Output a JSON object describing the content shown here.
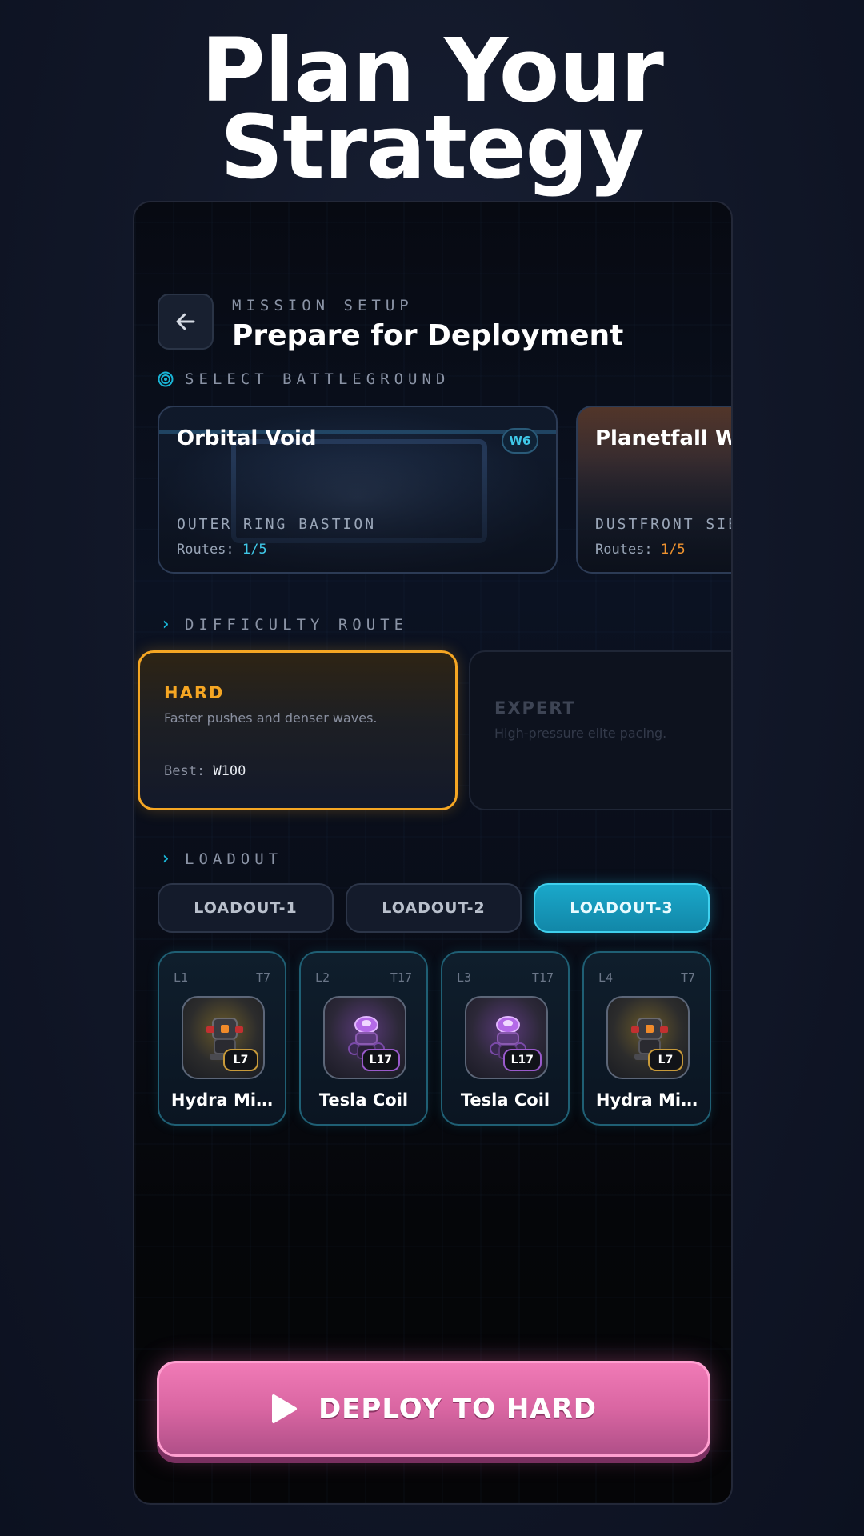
{
  "headline": {
    "line1": "Plan Your",
    "line2": "Strategy"
  },
  "header": {
    "eyebrow": "MISSION SETUP",
    "title": "Prepare for Deployment",
    "back_icon": "arrow-left-icon"
  },
  "battleground": {
    "section_label": "SELECT BATTLEGROUND",
    "section_icon": "target-icon",
    "cards": [
      {
        "title": "Orbital Void",
        "subtitle": "OUTER RING BASTION",
        "routes_label": "Routes:",
        "routes_value": "1/5",
        "badge": "W6"
      },
      {
        "title": "Planetfall Wa",
        "subtitle": "DUSTFRONT SIE",
        "routes_label": "Routes:",
        "routes_value": "1/5"
      }
    ]
  },
  "difficulty": {
    "section_label": "DIFFICULTY ROUTE",
    "section_icon": "chevron-right-icon",
    "options": [
      {
        "name": "HARD",
        "description": "Faster pushes and denser waves.",
        "best_label": "Best:",
        "best_value": "W100",
        "selected": true
      },
      {
        "name": "EXPERT",
        "description": "High-pressure elite pacing.",
        "selected": false
      }
    ]
  },
  "loadout": {
    "section_label": "LOADOUT",
    "section_icon": "chevron-right-icon",
    "tabs": [
      {
        "label": "LOADOUT-1",
        "active": false
      },
      {
        "label": "LOADOUT-2",
        "active": false
      },
      {
        "label": "LOADOUT-3",
        "active": true
      }
    ],
    "units": [
      {
        "slot": "L1",
        "tier": "T7",
        "level": "L7",
        "name": "Hydra Mi…",
        "icon": "hydra-turret-icon"
      },
      {
        "slot": "L2",
        "tier": "T17",
        "level": "L17",
        "name": "Tesla Coil",
        "icon": "tesla-coil-icon"
      },
      {
        "slot": "L3",
        "tier": "T17",
        "level": "L17",
        "name": "Tesla Coil",
        "icon": "tesla-coil-icon"
      },
      {
        "slot": "L4",
        "tier": "T7",
        "level": "L7",
        "name": "Hydra Mi…",
        "icon": "hydra-turret-icon"
      }
    ]
  },
  "deploy": {
    "label": "DEPLOY TO HARD",
    "icon": "play-icon"
  },
  "colors": {
    "accent_cyan": "#19b4d6",
    "hard_orange": "#f5a623",
    "deploy_pink": "#e271ac",
    "background": "#121829"
  }
}
